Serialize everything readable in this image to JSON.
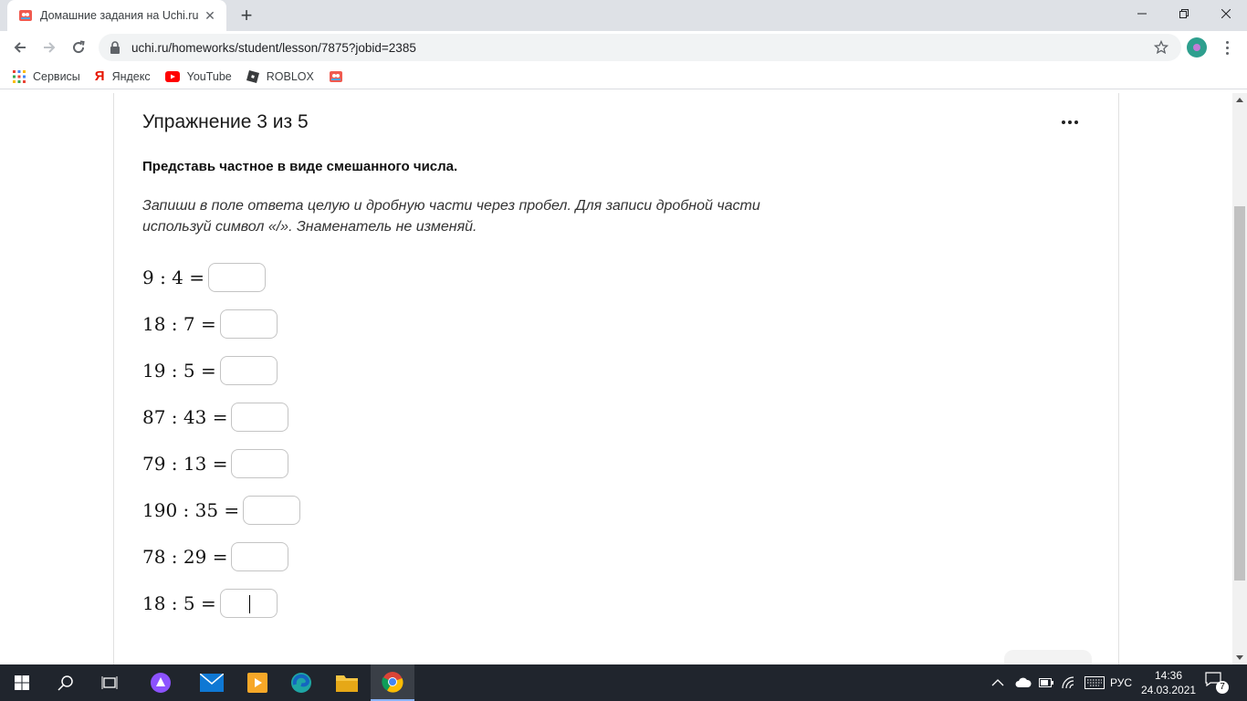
{
  "browser": {
    "tab_title": "Домашние задания на Uchi.ru",
    "url": "uchi.ru/homeworks/student/lesson/7875?jobid=2385",
    "bookmarks": [
      {
        "label": "Сервисы",
        "icon": "apps-grid-icon"
      },
      {
        "label": "Яндекс",
        "icon": "yandex-icon"
      },
      {
        "label": "YouTube",
        "icon": "youtube-icon"
      },
      {
        "label": "ROBLOX",
        "icon": "roblox-icon"
      },
      {
        "label": "",
        "icon": "uchi-icon"
      }
    ]
  },
  "page": {
    "exercise_title": "Упражнение 3 из 5",
    "task": "Представь частное в виде смешанного числа.",
    "hint": "Запиши в поле ответа целую и дробную части через пробел. Для записи дробной части используй символ «/». Знаменатель не изменяй.",
    "exercises": [
      {
        "expr": "9 : 4 =",
        "value": ""
      },
      {
        "expr": "18 : 7 =",
        "value": ""
      },
      {
        "expr": "19 : 5 =",
        "value": ""
      },
      {
        "expr": "87 : 43 =",
        "value": ""
      },
      {
        "expr": "79 : 13 =",
        "value": ""
      },
      {
        "expr": "190 : 35 =",
        "value": ""
      },
      {
        "expr": "78 : 29 =",
        "value": ""
      },
      {
        "expr": "18 : 5 =",
        "value": "",
        "focused": true
      }
    ]
  },
  "taskbar": {
    "apps": [
      "windows-start-icon",
      "search-icon",
      "task-view-icon",
      "alice-icon",
      "mail-icon",
      "media-player-icon",
      "edge-icon",
      "file-explorer-icon",
      "chrome-icon"
    ],
    "language": "РУС",
    "time": "14:36",
    "date": "24.03.2021",
    "notifications": "7"
  },
  "colors": {
    "tab_strip": "#dee1e6",
    "taskbar": "#20252d",
    "accent": "#8ab4f8"
  }
}
